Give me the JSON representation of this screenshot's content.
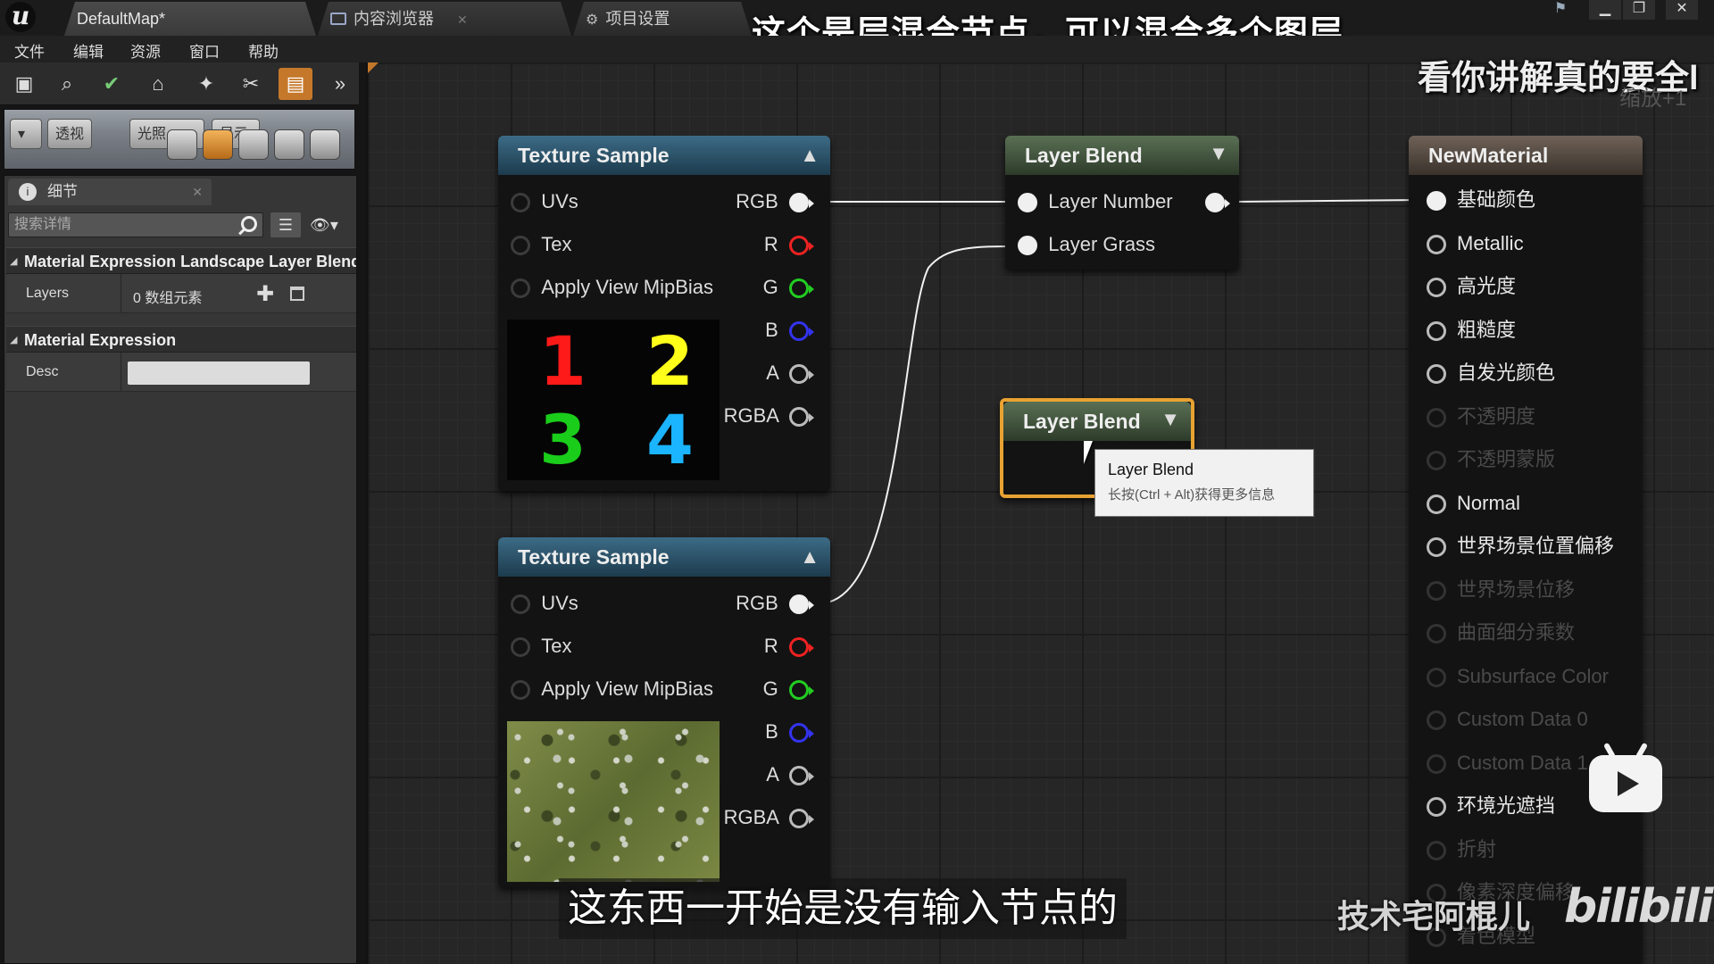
{
  "titlebar": {
    "tabs": [
      {
        "label": "DefaultMap*"
      },
      {
        "label": "内容浏览器"
      },
      {
        "label": "项目设置"
      }
    ],
    "caption": "这个是层混合节点，可以混合多个图层"
  },
  "menu": [
    "文件",
    "编辑",
    "资源",
    "窗口",
    "帮助"
  ],
  "viewport": {
    "perspective_label": "透视",
    "lit_label": "光照",
    "show_label": "显示"
  },
  "details": {
    "tab_label": "细节",
    "search_placeholder": "搜索详情",
    "sections": [
      {
        "title": "Material Expression Landscape Layer Blend"
      },
      {
        "title": "Material Expression"
      }
    ],
    "layers_label": "Layers",
    "layers_value": "0 数组元素",
    "desc_label": "Desc"
  },
  "nodes": {
    "texture_sample_1": {
      "title": "Texture Sample",
      "inputs": [
        "UVs",
        "Tex",
        "Apply View MipBias"
      ],
      "outputs": [
        "RGB",
        "R",
        "G",
        "B",
        "A",
        "RGBA"
      ],
      "preview_digits": [
        "1",
        "2",
        "3",
        "4"
      ]
    },
    "texture_sample_2": {
      "title": "Texture Sample",
      "inputs": [
        "UVs",
        "Tex",
        "Apply View MipBias"
      ],
      "outputs": [
        "RGB",
        "R",
        "G",
        "B",
        "A",
        "RGBA"
      ]
    },
    "layer_blend_1": {
      "title": "Layer Blend",
      "inputs": [
        "Layer Number",
        "Layer Grass"
      ]
    },
    "layer_blend_2": {
      "title": "Layer Blend"
    },
    "result": {
      "title": "NewMaterial",
      "pins": [
        {
          "label": "基础颜色",
          "enabled": true
        },
        {
          "label": "Metallic",
          "enabled": true
        },
        {
          "label": "高光度",
          "enabled": true
        },
        {
          "label": "粗糙度",
          "enabled": true
        },
        {
          "label": "自发光颜色",
          "enabled": true
        },
        {
          "label": "不透明度",
          "enabled": false
        },
        {
          "label": "不透明蒙版",
          "enabled": false
        },
        {
          "label": "Normal",
          "enabled": true
        },
        {
          "label": "世界场景位置偏移",
          "enabled": true
        },
        {
          "label": "世界场景位移",
          "enabled": false
        },
        {
          "label": "曲面细分乘数",
          "enabled": false
        },
        {
          "label": "Subsurface Color",
          "enabled": false
        },
        {
          "label": "Custom Data 0",
          "enabled": false
        },
        {
          "label": "Custom Data 1",
          "enabled": false
        },
        {
          "label": "环境光遮挡",
          "enabled": true
        },
        {
          "label": "折射",
          "enabled": false
        },
        {
          "label": "像素深度偏移",
          "enabled": false
        },
        {
          "label": "着色模型",
          "enabled": false
        }
      ]
    }
  },
  "tooltip": {
    "title": "Layer Blend",
    "hint": "长按(Ctrl + Alt)获得更多信息"
  },
  "overlays": {
    "caption_right": "看你讲解真的要全l",
    "zoom": "缩放+1",
    "subtitle": "这东西一开始是没有输入节点的",
    "watermark": "技术宅阿棍儿",
    "bili": "bilibili"
  },
  "colors": {
    "accent": "#c5782a",
    "selection": "#e8a232",
    "texture_header": "#3c6b86",
    "blend_header": "#5a7054",
    "result_header": "#6f6258",
    "digit_1": "#ff1a1a",
    "digit_2": "#ffff1a",
    "digit_3": "#1acd1a",
    "digit_4": "#1ab4ff"
  }
}
